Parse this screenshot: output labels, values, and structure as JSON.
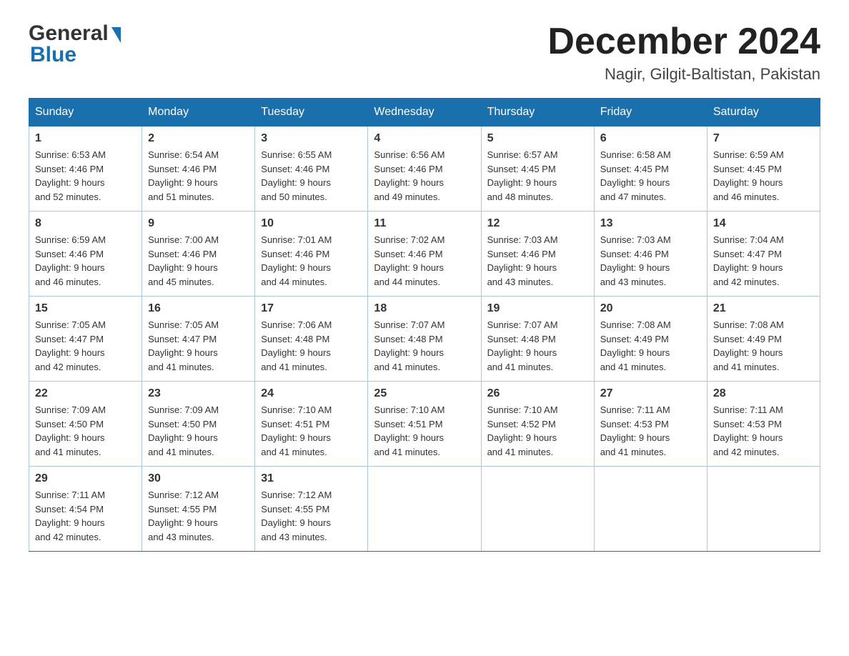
{
  "header": {
    "logo_general": "General",
    "logo_blue": "Blue",
    "month_title": "December 2024",
    "location": "Nagir, Gilgit-Baltistan, Pakistan"
  },
  "days_of_week": [
    "Sunday",
    "Monday",
    "Tuesday",
    "Wednesday",
    "Thursday",
    "Friday",
    "Saturday"
  ],
  "weeks": [
    [
      {
        "day": "1",
        "sunrise": "6:53 AM",
        "sunset": "4:46 PM",
        "daylight": "9 hours and 52 minutes."
      },
      {
        "day": "2",
        "sunrise": "6:54 AM",
        "sunset": "4:46 PM",
        "daylight": "9 hours and 51 minutes."
      },
      {
        "day": "3",
        "sunrise": "6:55 AM",
        "sunset": "4:46 PM",
        "daylight": "9 hours and 50 minutes."
      },
      {
        "day": "4",
        "sunrise": "6:56 AM",
        "sunset": "4:46 PM",
        "daylight": "9 hours and 49 minutes."
      },
      {
        "day": "5",
        "sunrise": "6:57 AM",
        "sunset": "4:45 PM",
        "daylight": "9 hours and 48 minutes."
      },
      {
        "day": "6",
        "sunrise": "6:58 AM",
        "sunset": "4:45 PM",
        "daylight": "9 hours and 47 minutes."
      },
      {
        "day": "7",
        "sunrise": "6:59 AM",
        "sunset": "4:45 PM",
        "daylight": "9 hours and 46 minutes."
      }
    ],
    [
      {
        "day": "8",
        "sunrise": "6:59 AM",
        "sunset": "4:46 PM",
        "daylight": "9 hours and 46 minutes."
      },
      {
        "day": "9",
        "sunrise": "7:00 AM",
        "sunset": "4:46 PM",
        "daylight": "9 hours and 45 minutes."
      },
      {
        "day": "10",
        "sunrise": "7:01 AM",
        "sunset": "4:46 PM",
        "daylight": "9 hours and 44 minutes."
      },
      {
        "day": "11",
        "sunrise": "7:02 AM",
        "sunset": "4:46 PM",
        "daylight": "9 hours and 44 minutes."
      },
      {
        "day": "12",
        "sunrise": "7:03 AM",
        "sunset": "4:46 PM",
        "daylight": "9 hours and 43 minutes."
      },
      {
        "day": "13",
        "sunrise": "7:03 AM",
        "sunset": "4:46 PM",
        "daylight": "9 hours and 43 minutes."
      },
      {
        "day": "14",
        "sunrise": "7:04 AM",
        "sunset": "4:47 PM",
        "daylight": "9 hours and 42 minutes."
      }
    ],
    [
      {
        "day": "15",
        "sunrise": "7:05 AM",
        "sunset": "4:47 PM",
        "daylight": "9 hours and 42 minutes."
      },
      {
        "day": "16",
        "sunrise": "7:05 AM",
        "sunset": "4:47 PM",
        "daylight": "9 hours and 41 minutes."
      },
      {
        "day": "17",
        "sunrise": "7:06 AM",
        "sunset": "4:48 PM",
        "daylight": "9 hours and 41 minutes."
      },
      {
        "day": "18",
        "sunrise": "7:07 AM",
        "sunset": "4:48 PM",
        "daylight": "9 hours and 41 minutes."
      },
      {
        "day": "19",
        "sunrise": "7:07 AM",
        "sunset": "4:48 PM",
        "daylight": "9 hours and 41 minutes."
      },
      {
        "day": "20",
        "sunrise": "7:08 AM",
        "sunset": "4:49 PM",
        "daylight": "9 hours and 41 minutes."
      },
      {
        "day": "21",
        "sunrise": "7:08 AM",
        "sunset": "4:49 PM",
        "daylight": "9 hours and 41 minutes."
      }
    ],
    [
      {
        "day": "22",
        "sunrise": "7:09 AM",
        "sunset": "4:50 PM",
        "daylight": "9 hours and 41 minutes."
      },
      {
        "day": "23",
        "sunrise": "7:09 AM",
        "sunset": "4:50 PM",
        "daylight": "9 hours and 41 minutes."
      },
      {
        "day": "24",
        "sunrise": "7:10 AM",
        "sunset": "4:51 PM",
        "daylight": "9 hours and 41 minutes."
      },
      {
        "day": "25",
        "sunrise": "7:10 AM",
        "sunset": "4:51 PM",
        "daylight": "9 hours and 41 minutes."
      },
      {
        "day": "26",
        "sunrise": "7:10 AM",
        "sunset": "4:52 PM",
        "daylight": "9 hours and 41 minutes."
      },
      {
        "day": "27",
        "sunrise": "7:11 AM",
        "sunset": "4:53 PM",
        "daylight": "9 hours and 41 minutes."
      },
      {
        "day": "28",
        "sunrise": "7:11 AM",
        "sunset": "4:53 PM",
        "daylight": "9 hours and 42 minutes."
      }
    ],
    [
      {
        "day": "29",
        "sunrise": "7:11 AM",
        "sunset": "4:54 PM",
        "daylight": "9 hours and 42 minutes."
      },
      {
        "day": "30",
        "sunrise": "7:12 AM",
        "sunset": "4:55 PM",
        "daylight": "9 hours and 43 minutes."
      },
      {
        "day": "31",
        "sunrise": "7:12 AM",
        "sunset": "4:55 PM",
        "daylight": "9 hours and 43 minutes."
      },
      null,
      null,
      null,
      null
    ]
  ],
  "labels": {
    "sunrise": "Sunrise:",
    "sunset": "Sunset:",
    "daylight": "Daylight:"
  }
}
